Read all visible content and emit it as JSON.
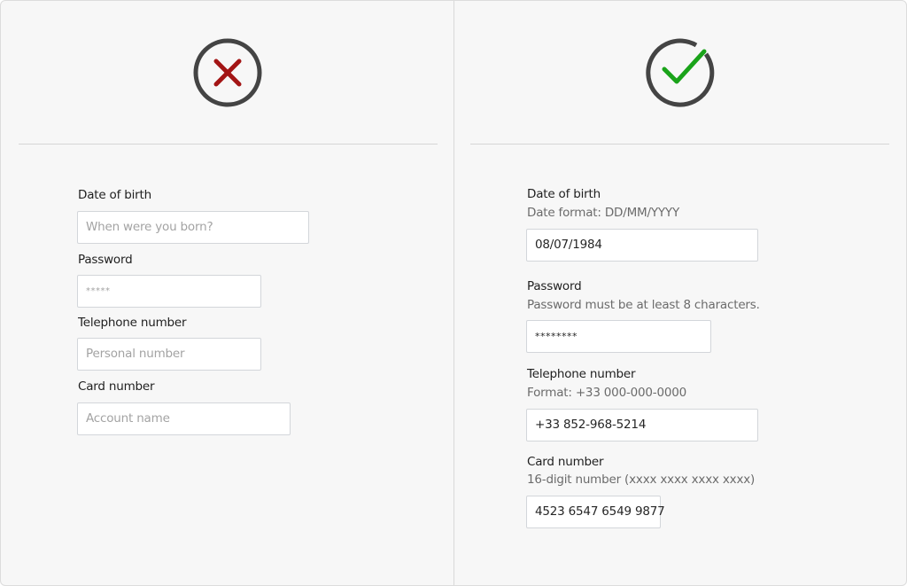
{
  "colors": {
    "bad": "#a31515",
    "good": "#1aa31a",
    "ring": "#444444"
  },
  "bad_example": {
    "icon": "x-circle-icon",
    "fields": [
      {
        "label": "Date of birth",
        "placeholder": "When were you born?"
      },
      {
        "label": "Password",
        "placeholder": "*****"
      },
      {
        "label": "Telephone number",
        "placeholder": "Personal number"
      },
      {
        "label": "Card number",
        "placeholder": "Account name"
      }
    ]
  },
  "good_example": {
    "icon": "check-circle-icon",
    "fields": [
      {
        "label": "Date of birth",
        "hint": "Date format: DD/MM/YYYY",
        "value": "08/07/1984"
      },
      {
        "label": "Password",
        "hint": "Password must be at least 8 characters.",
        "value": "********"
      },
      {
        "label": "Telephone number",
        "hint": "Format: +33 000-000-0000",
        "value": "+33 852-968-5214"
      },
      {
        "label": "Card number",
        "hint": "16-digit number (xxxx xxxx xxxx xxxx)",
        "value": "4523 6547 6549 9877"
      }
    ]
  }
}
